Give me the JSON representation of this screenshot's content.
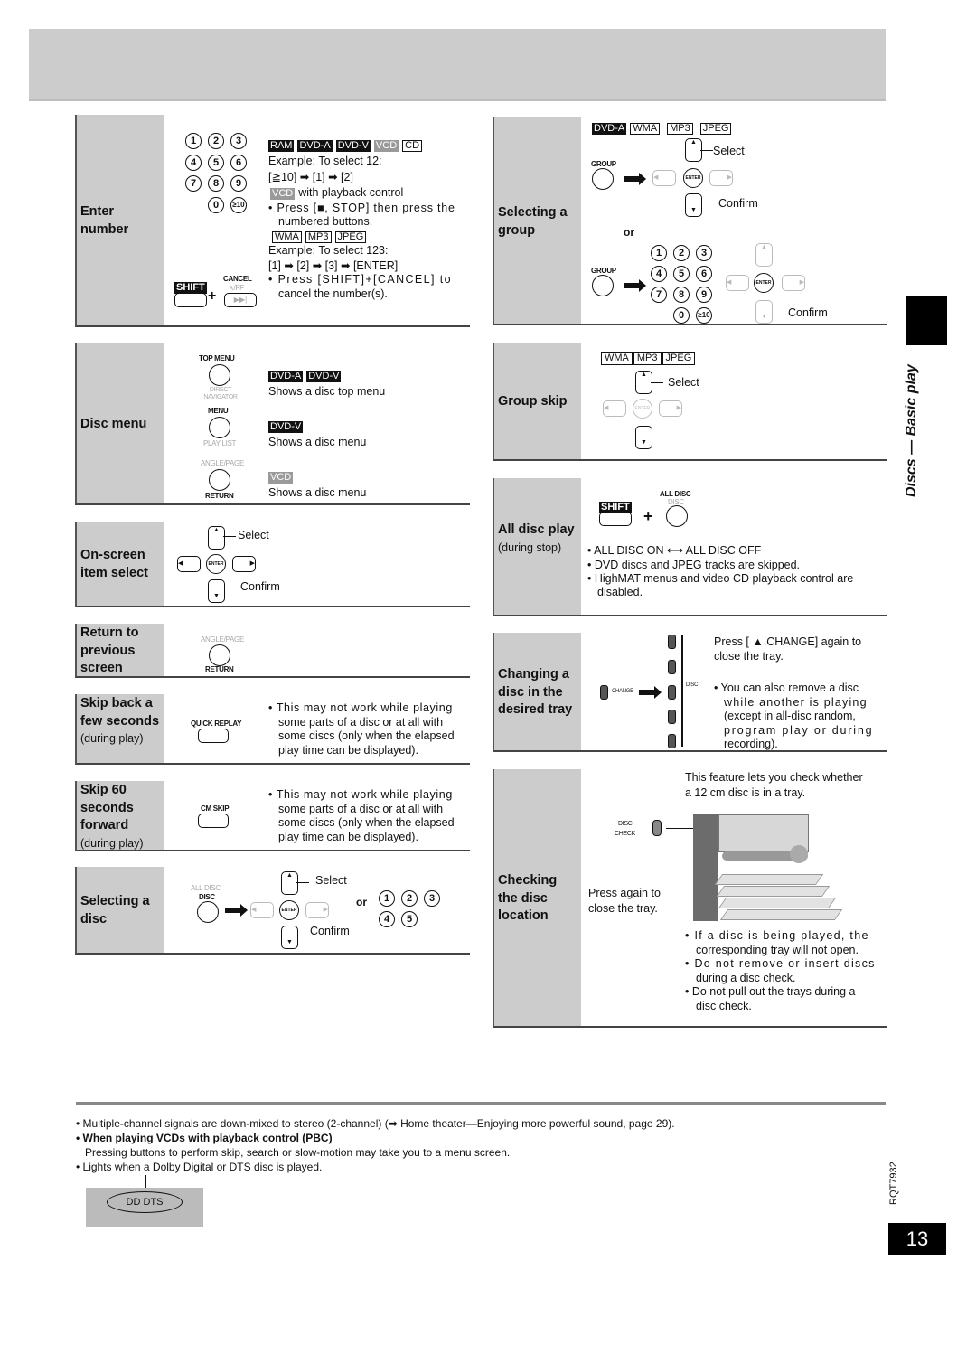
{
  "side_title": "Discs — Basic play",
  "page_number": "13",
  "doc_code": "RQT7932",
  "sections_left": {
    "enter_number": {
      "label": "Enter number",
      "keypad": [
        "1",
        "2",
        "3",
        "4",
        "5",
        "6",
        "7",
        "8",
        "9",
        "0",
        "≥10"
      ],
      "tags1": [
        "RAM",
        "DVD-A",
        "DVD-V",
        "VCD",
        "CD"
      ],
      "example1": "Example: To select 12:",
      "seq1": "[≧10] ➡ [1] ➡ [2]",
      "vcd_tag": "VCD",
      "vcd_note": "with playback control",
      "bullet1": "• Press [■, STOP] then press the",
      "bullet1b": "numbered buttons.",
      "tags2": [
        "WMA",
        "MP3",
        "JPEG"
      ],
      "example2": "Example: To select 123:",
      "seq2": "[1] ➡ [2] ➡ [3] ➡ [ENTER]",
      "bullet2": "• Press [SHIFT]+[CANCEL] to",
      "bullet2b": "cancel the number(s).",
      "shift_label": "SHIFT",
      "cancel_label": "CANCEL",
      "cancel_sub": "∧/FF",
      "plus": "+"
    },
    "disc_menu": {
      "label": "Disc menu",
      "btn1_top": "TOP MENU",
      "btn1_bottom": "DIRECT NAVIGATOR",
      "btn2_top": "MENU",
      "btn2_bottom": "PLAY LIST",
      "btn3_top": "ANGLE/PAGE",
      "btn3_bottom": "RETURN",
      "row1_tags": [
        "DVD-A",
        "DVD-V"
      ],
      "row1_text": "Shows a disc top menu",
      "row2_tag": "DVD-V",
      "row2_text": "Shows a disc menu",
      "row3_tag": "VCD",
      "row3_text": "Shows a disc menu"
    },
    "onscreen": {
      "label": "On-screen item select",
      "select": "Select",
      "confirm": "Confirm",
      "enter": "ENTER"
    },
    "return_prev": {
      "label": "Return to previous screen",
      "btn_top": "ANGLE/PAGE",
      "btn_bottom": "RETURN"
    },
    "skip_back": {
      "label": "Skip back a few seconds",
      "sub": "(during play)",
      "btn": "QUICK REPLAY",
      "lines": [
        "• This may not work while playing",
        "some parts of a disc or at all with",
        "some discs (only when the elapsed",
        "play time can be displayed)."
      ]
    },
    "skip60": {
      "label": "Skip 60 seconds forward",
      "sub": "(during play)",
      "btn": "CM SKIP",
      "lines": [
        "• This may not work while playing",
        "some parts of a disc or at all with",
        "some discs (only when the elapsed",
        "play time can be displayed)."
      ]
    },
    "select_disc": {
      "label": "Selecting a disc",
      "btn_top": "ALL DISC",
      "btn_bottom": "DISC",
      "select": "Select",
      "confirm": "Confirm",
      "or": "or",
      "enter": "ENTER",
      "keys": [
        "1",
        "2",
        "3",
        "4",
        "5"
      ]
    }
  },
  "sections_right": {
    "select_group": {
      "label": "Selecting a group",
      "tags": [
        "DVD-A",
        "WMA",
        "MP3",
        "JPEG"
      ],
      "group": "GROUP",
      "select": "Select",
      "confirm": "Confirm",
      "or": "or",
      "enter": "ENTER",
      "keypad": [
        "1",
        "2",
        "3",
        "4",
        "5",
        "6",
        "7",
        "8",
        "9",
        "0",
        "≥10"
      ],
      "confirm2": "Confirm"
    },
    "group_skip": {
      "label": "Group skip",
      "tags": [
        "WMA",
        "MP3",
        "JPEG"
      ],
      "select": "Select",
      "enter": "ENTER"
    },
    "all_disc": {
      "label": "All disc play",
      "sub": "(during stop)",
      "shift": "SHIFT",
      "btn_top": "ALL DISC",
      "btn_bottom": "DISC",
      "plus": "+",
      "bullets": [
        "• ALL DISC ON ⟷ ALL DISC OFF",
        "• DVD discs and JPEG tracks are skipped.",
        "• HighMAT menus and video CD playback control are"
      ],
      "bullet3b": "disabled."
    },
    "change_disc": {
      "label": "Changing a disc in the desired tray",
      "change": "CHANGE",
      "disc": "DISC",
      "press1": "Press [ ▲,CHANGE] again to",
      "press1b": "close the tray.",
      "lines": [
        "• You can also remove a disc",
        "while another is playing",
        "(except in all-disc random,",
        "program play or during",
        "recording)."
      ]
    },
    "check_disc": {
      "label": "Checking the disc location",
      "intro1": "This feature lets you check whether",
      "intro2": "a 12 cm disc is in a tray.",
      "btn_l1": "DISC",
      "btn_l2": "CHECK",
      "press_again1": "Press again to",
      "press_again2": "close the tray.",
      "lines": [
        "• If a disc is being played, the",
        "corresponding tray will not open.",
        "• Do not remove or insert discs",
        "during a disc check.",
        "• Do not pull out the trays during a",
        "disc check."
      ]
    }
  },
  "footnotes": {
    "line1": "• Multiple-channel signals are down-mixed to stereo (2-channel) (➡ Home theater—Enjoying more powerful sound, page 29).",
    "line2": "• When playing VCDs with playback control (PBC)",
    "line3": "Pressing buttons to perform skip, search or slow-motion may take you to a menu screen.",
    "line4": "• Lights when a Dolby Digital or DTS disc is played.",
    "dolby": "DD DTS"
  }
}
